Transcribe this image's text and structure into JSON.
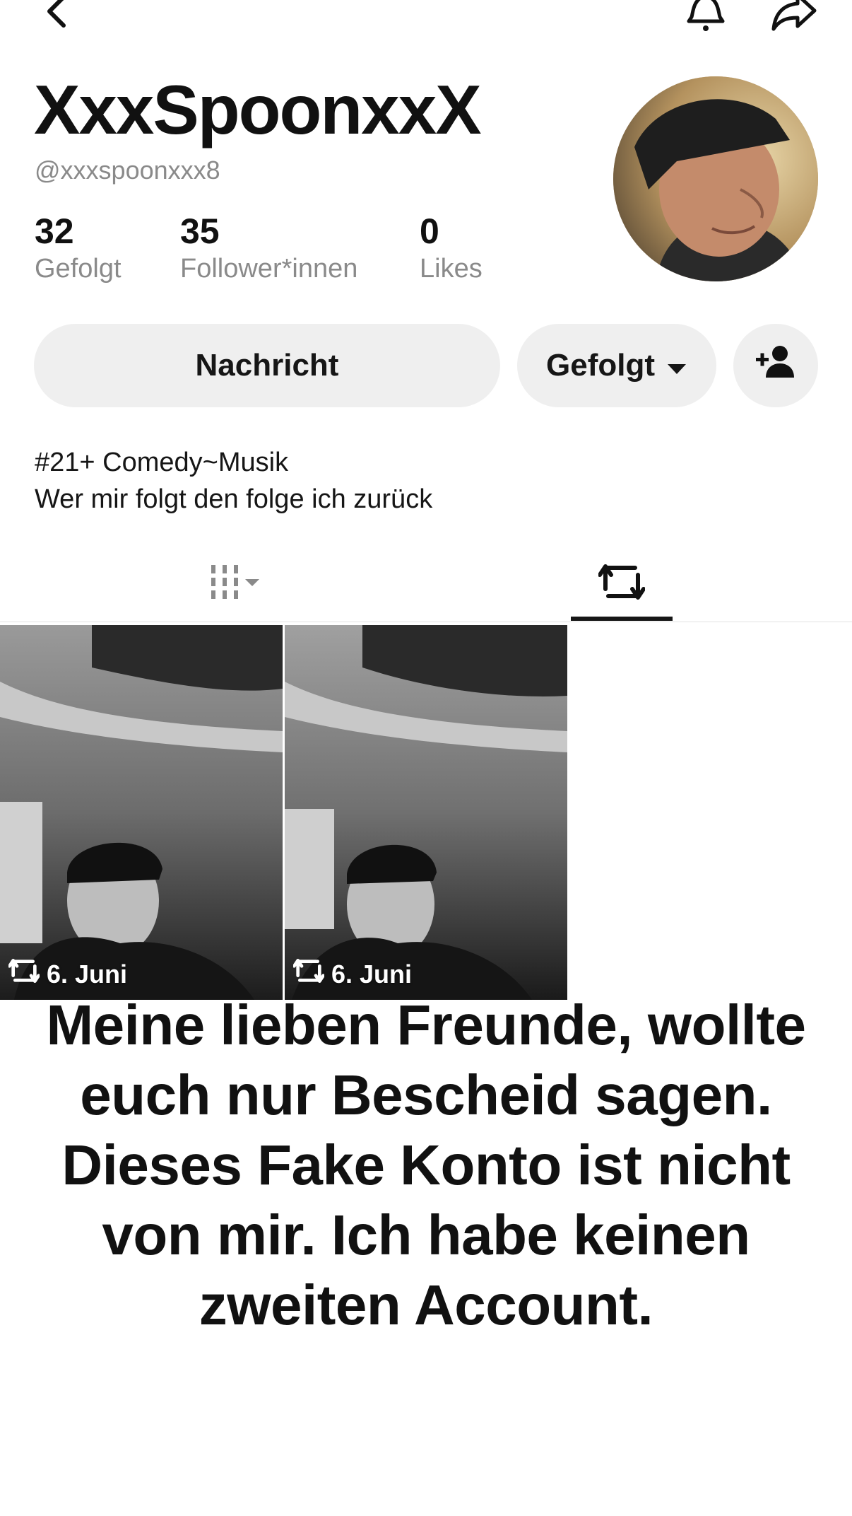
{
  "profile": {
    "display_name": "XxxSpoonxxX",
    "handle": "@xxxspoonxxx8"
  },
  "stats": [
    {
      "value": "32",
      "label": "Gefolgt"
    },
    {
      "value": "35",
      "label": "Follower*innen"
    },
    {
      "value": "0",
      "label": "Likes"
    }
  ],
  "actions": {
    "message_label": "Nachricht",
    "follow_label": "Gefolgt"
  },
  "bio": {
    "line1": "#21+ Comedy~Musik",
    "line2": "Wer mir folgt den folge ich zurück"
  },
  "tabs": [
    {
      "icon": "grid-icon",
      "active": false
    },
    {
      "icon": "repost-icon",
      "active": true
    }
  ],
  "videos": [
    {
      "caption": "6. Juni",
      "icon": "repost-icon"
    },
    {
      "caption": "6. Juni",
      "icon": "repost-icon"
    }
  ],
  "overlay_text": "Meine lieben Freunde, wollte euch nur Bescheid sagen. Dieses Fake Konto ist nicht von mir. Ich habe keinen zweiten Account."
}
